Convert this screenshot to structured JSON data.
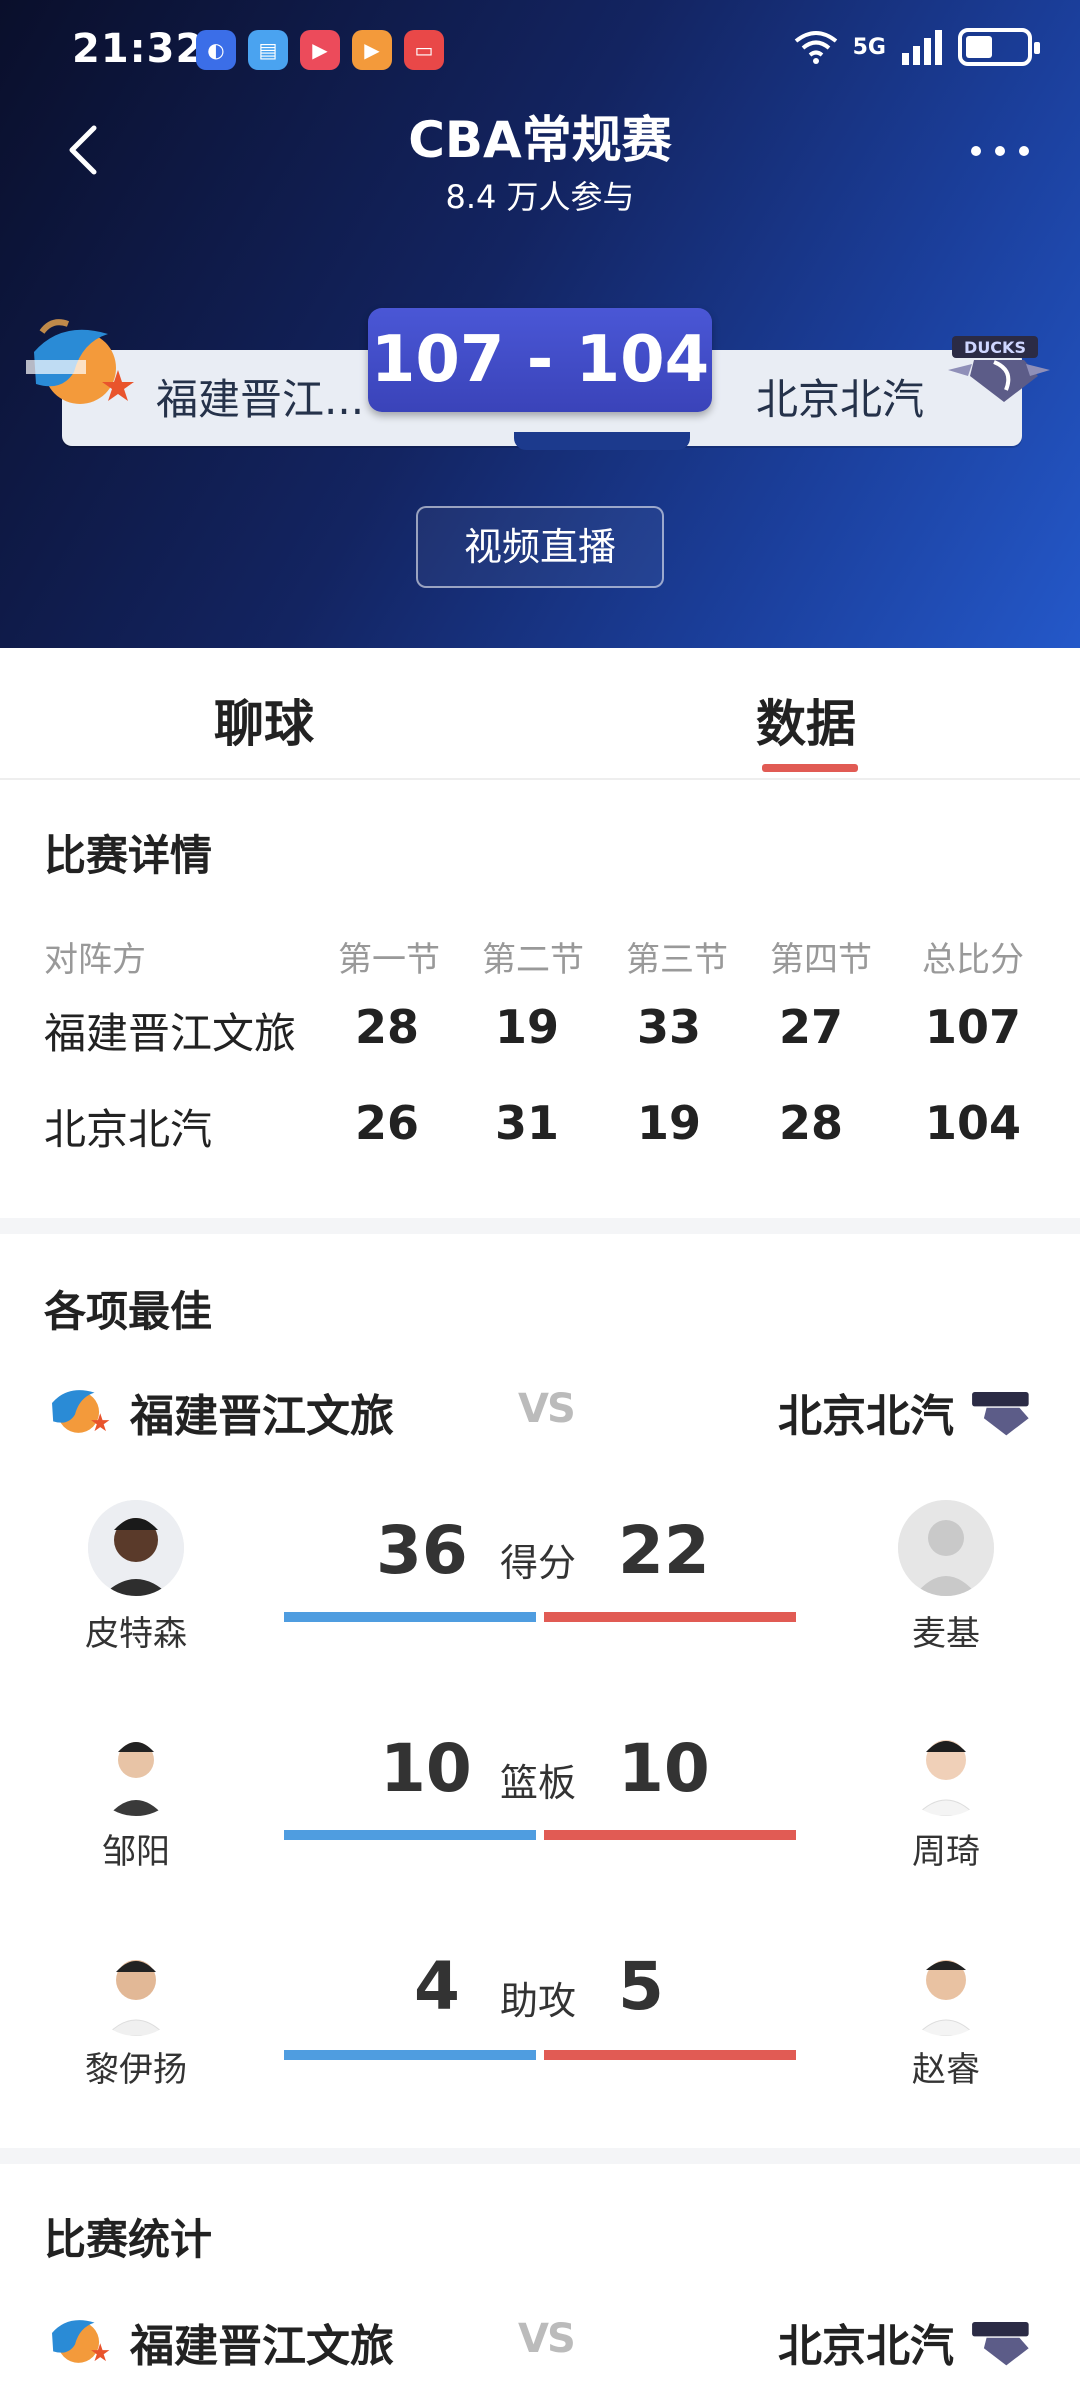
{
  "status_bar": {
    "time": "21:32",
    "signal_label": "5G"
  },
  "header": {
    "title": "CBA常规赛",
    "subtitle": "8.4 万人参与",
    "team_left": "福建晋江...",
    "team_right": "北京北汽",
    "score": "107 - 104",
    "live_button": "视频直播"
  },
  "tabs": [
    {
      "label": "聊球"
    },
    {
      "label": "数据"
    }
  ],
  "match_details": {
    "title": "比赛详情",
    "columns": [
      "对阵方",
      "第一节",
      "第二节",
      "第三节",
      "第四节",
      "总比分"
    ],
    "rows": [
      {
        "team": "福建晋江文旅",
        "q1": "28",
        "q2": "19",
        "q3": "33",
        "q4": "27",
        "total": "107"
      },
      {
        "team": "北京北汽",
        "q1": "26",
        "q2": "31",
        "q3": "19",
        "q4": "28",
        "total": "104"
      }
    ]
  },
  "best": {
    "title": "各项最佳",
    "team_left": "福建晋江文旅",
    "team_right": "北京北汽",
    "vs": "VS",
    "stats": [
      {
        "label": "得分",
        "left_player": "皮特森",
        "left_value": "36",
        "right_player": "麦基",
        "right_value": "22"
      },
      {
        "label": "篮板",
        "left_player": "邹阳",
        "left_value": "10",
        "right_player": "周琦",
        "right_value": "10"
      },
      {
        "label": "助攻",
        "left_player": "黎伊扬",
        "left_value": "4",
        "right_player": "赵睿",
        "right_value": "5"
      }
    ]
  },
  "match_stats": {
    "title": "比赛统计",
    "team_left": "福建晋江文旅",
    "team_right": "北京北汽",
    "vs": "VS"
  },
  "colors": {
    "accent_red": "#e15b54",
    "accent_blue": "#4f9de0",
    "score_box": "#3a43b9"
  }
}
